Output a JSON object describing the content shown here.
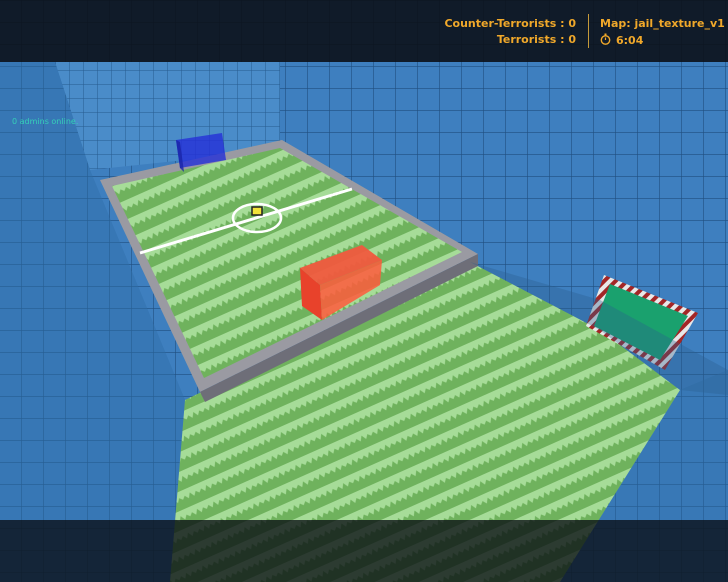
{
  "scoreboard": {
    "ct_label": "Counter-Terrorists : 0",
    "t_label": "Terrorists : 0",
    "map_label": "Map: jail_texture_v1",
    "time": "6:04",
    "timer_icon": "stopwatch-icon",
    "text_color": "#f0a82a"
  },
  "chat": {
    "admins_msg": "0 admins online."
  },
  "scene": {
    "wall_color": "#3e7fbf",
    "grass_light": "#a6dc98",
    "grass_dark": "#6fb25d",
    "border_color": "#9a9aa2",
    "red_block_color": "#e8422b",
    "blue_goal_color": "#2430d8",
    "green_panel_color": "#1aa16e"
  }
}
